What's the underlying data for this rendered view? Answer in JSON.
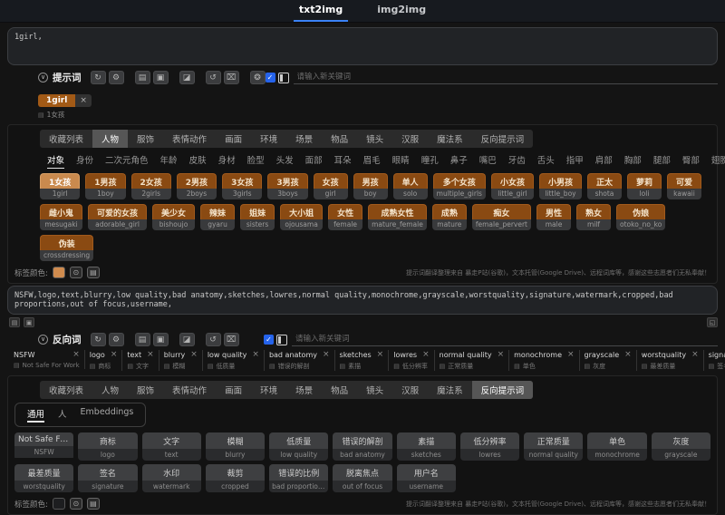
{
  "topbar": {
    "tabs": [
      {
        "label": "txt2img",
        "name": "tab-txt2img",
        "active": true
      },
      {
        "label": "img2img",
        "name": "tab-img2img",
        "active": false
      }
    ]
  },
  "colors": {
    "accent_blue": "#3b82f6",
    "tag_orange": "#8a4a12",
    "tag_orange_selected": "#c98a4e",
    "checkbox_blue": "#2563eb",
    "pos_swatch": "#cf8b4e",
    "neg_swatch": "#1d1e20"
  },
  "prompt_section": {
    "textarea_value": "1girl,",
    "header_label": "提示词",
    "tools": [
      {
        "glyph": "↻",
        "name": "refresh-icon"
      },
      {
        "glyph": "⚙",
        "name": "settings-icon"
      },
      {
        "glyph": "▤",
        "name": "save-icon"
      },
      {
        "glyph": "▣",
        "name": "notebook-icon"
      },
      {
        "glyph": "◪",
        "name": "image-icon"
      },
      {
        "glyph": "↺",
        "name": "history-icon"
      },
      {
        "glyph": "⌧",
        "name": "trash-icon"
      },
      {
        "glyph": "❂",
        "name": "translate-icon"
      }
    ],
    "keyword_placeholder": "请输入新关键词",
    "selected_tags": [
      {
        "en": "1girl",
        "zh": "1女孩"
      }
    ]
  },
  "category_tabs_top": [
    {
      "label": "收藏列表"
    },
    {
      "label": "人物",
      "active": true
    },
    {
      "label": "服饰"
    },
    {
      "label": "表情动作"
    },
    {
      "label": "画面"
    },
    {
      "label": "环境"
    },
    {
      "label": "场景"
    },
    {
      "label": "物品"
    },
    {
      "label": "镜头"
    },
    {
      "label": "汉服"
    },
    {
      "label": "魔法系"
    },
    {
      "label": "反向提示词"
    }
  ],
  "subcategories": [
    {
      "label": "对象",
      "active": true
    },
    {
      "label": "身份"
    },
    {
      "label": "二次元角色"
    },
    {
      "label": "年龄"
    },
    {
      "label": "皮肤"
    },
    {
      "label": "身材"
    },
    {
      "label": "脸型"
    },
    {
      "label": "头发"
    },
    {
      "label": "面部"
    },
    {
      "label": "耳朵"
    },
    {
      "label": "眉毛"
    },
    {
      "label": "眼睛"
    },
    {
      "label": "瞳孔"
    },
    {
      "label": "鼻子"
    },
    {
      "label": "嘴巴"
    },
    {
      "label": "牙齿"
    },
    {
      "label": "舌头"
    },
    {
      "label": "指甲"
    },
    {
      "label": "肩部"
    },
    {
      "label": "胸部"
    },
    {
      "label": "腿部"
    },
    {
      "label": "臀部"
    },
    {
      "label": "翅膀"
    }
  ],
  "pos_tags": [
    {
      "zh": "1女孩",
      "en": "1girl",
      "selected": true
    },
    {
      "zh": "1男孩",
      "en": "1boy"
    },
    {
      "zh": "2女孩",
      "en": "2girls"
    },
    {
      "zh": "2男孩",
      "en": "2boys"
    },
    {
      "zh": "3女孩",
      "en": "3girls"
    },
    {
      "zh": "3男孩",
      "en": "3boys"
    },
    {
      "zh": "女孩",
      "en": "girl"
    },
    {
      "zh": "男孩",
      "en": "boy"
    },
    {
      "zh": "单人",
      "en": "solo"
    },
    {
      "zh": "多个女孩",
      "en": "multiple_girls"
    },
    {
      "zh": "小女孩",
      "en": "little_girl"
    },
    {
      "zh": "小男孩",
      "en": "little_boy"
    },
    {
      "zh": "正太",
      "en": "shota"
    },
    {
      "zh": "萝莉",
      "en": "loli"
    },
    {
      "zh": "可爱",
      "en": "kawaii"
    },
    {
      "zh": "雌小鬼",
      "en": "mesugaki"
    },
    {
      "zh": "可爱的女孩",
      "en": "adorable_girl"
    },
    {
      "zh": "美少女",
      "en": "bishoujo"
    },
    {
      "zh": "辣妹",
      "en": "gyaru"
    },
    {
      "zh": "姐妹",
      "en": "sisters"
    },
    {
      "zh": "大小姐",
      "en": "ojousama"
    },
    {
      "zh": "女性",
      "en": "female"
    },
    {
      "zh": "成熟女性",
      "en": "mature_female"
    },
    {
      "zh": "成熟",
      "en": "mature"
    },
    {
      "zh": "痴女",
      "en": "female_pervert"
    },
    {
      "zh": "男性",
      "en": "male"
    },
    {
      "zh": "熟女",
      "en": "milf"
    },
    {
      "zh": "伪娘",
      "en": "otoko_no_ko"
    },
    {
      "zh": "伪装",
      "en": "crossdressing"
    }
  ],
  "tag_color_top": {
    "label": "标签颜色:"
  },
  "credits": "提示词翻译整理来自 暴走P站(谷歌)，文本托管(Google Drive)、远程词库等，感谢这些志愿者们无私奉献！",
  "negative_section": {
    "textarea_value": "NSFW,logo,text,blurry,low quality,bad anatomy,sketches,lowres,normal quality,monochrome,grayscale,worstquality,signature,watermark,cropped,bad proportions,out of focus,username,",
    "header_label": "反向词",
    "tools": [
      {
        "glyph": "↻",
        "name": "refresh-icon"
      },
      {
        "glyph": "⚙",
        "name": "settings-icon"
      },
      {
        "glyph": "▤",
        "name": "save-icon"
      },
      {
        "glyph": "▣",
        "name": "notebook-icon"
      },
      {
        "glyph": "◪",
        "name": "image-icon"
      },
      {
        "glyph": "↺",
        "name": "history-icon"
      },
      {
        "glyph": "⌧",
        "name": "trash-icon"
      }
    ],
    "keyword_placeholder": "请输入新关键词",
    "selected_tags": [
      {
        "en": "NSFW",
        "zh": "Not Safe For Work"
      },
      {
        "en": "logo",
        "zh": "商标"
      },
      {
        "en": "text",
        "zh": "文字"
      },
      {
        "en": "blurry",
        "zh": "模糊"
      },
      {
        "en": "low quality",
        "zh": "低质量"
      },
      {
        "en": "bad anatomy",
        "zh": "错误的解剖"
      },
      {
        "en": "sketches",
        "zh": "素描"
      },
      {
        "en": "lowres",
        "zh": "低分辨率"
      },
      {
        "en": "normal quality",
        "zh": "正常质量"
      },
      {
        "en": "monochrome",
        "zh": "单色"
      },
      {
        "en": "grayscale",
        "zh": "灰度"
      },
      {
        "en": "worstquality",
        "zh": "最差质量"
      },
      {
        "en": "signature",
        "zh": "签名"
      },
      {
        "en": "watermark",
        "zh": "水印"
      },
      {
        "en": "cropped",
        "zh": "裁剪"
      },
      {
        "en": "bad proportions",
        "zh": "错误的比例"
      },
      {
        "en": "out of focus",
        "zh": "脱离焦点"
      },
      {
        "en": "username",
        "zh": "用户名"
      }
    ]
  },
  "category_tabs_bottom": [
    {
      "label": "收藏列表"
    },
    {
      "label": "人物"
    },
    {
      "label": "服饰"
    },
    {
      "label": "表情动作"
    },
    {
      "label": "画面"
    },
    {
      "label": "环境"
    },
    {
      "label": "场景"
    },
    {
      "label": "物品"
    },
    {
      "label": "镜头"
    },
    {
      "label": "汉服"
    },
    {
      "label": "魔法系"
    },
    {
      "label": "反向提示词",
      "active": true
    }
  ],
  "neg_subtabs": [
    {
      "label": "通用",
      "active": true
    },
    {
      "label": "人"
    },
    {
      "label": "Embeddings"
    }
  ],
  "neg_tags": [
    {
      "zh": "Not Safe For Work",
      "en": "NSFW"
    },
    {
      "zh": "商标",
      "en": "logo"
    },
    {
      "zh": "文字",
      "en": "text"
    },
    {
      "zh": "模糊",
      "en": "blurry"
    },
    {
      "zh": "低质量",
      "en": "low quality"
    },
    {
      "zh": "错误的解剖",
      "en": "bad anatomy"
    },
    {
      "zh": "素描",
      "en": "sketches"
    },
    {
      "zh": "低分辨率",
      "en": "lowres"
    },
    {
      "zh": "正常质量",
      "en": "normal quality"
    },
    {
      "zh": "单色",
      "en": "monochrome"
    },
    {
      "zh": "灰度",
      "en": "grayscale"
    },
    {
      "zh": "最差质量",
      "en": "worstquality"
    },
    {
      "zh": "签名",
      "en": "signature"
    },
    {
      "zh": "水印",
      "en": "watermark"
    },
    {
      "zh": "裁剪",
      "en": "cropped"
    },
    {
      "zh": "错误的比例",
      "en": "bad proportions"
    },
    {
      "zh": "脱离焦点",
      "en": "out of focus"
    },
    {
      "zh": "用户名",
      "en": "username"
    }
  ],
  "tag_color_bottom": {
    "label": "标签颜色:"
  }
}
